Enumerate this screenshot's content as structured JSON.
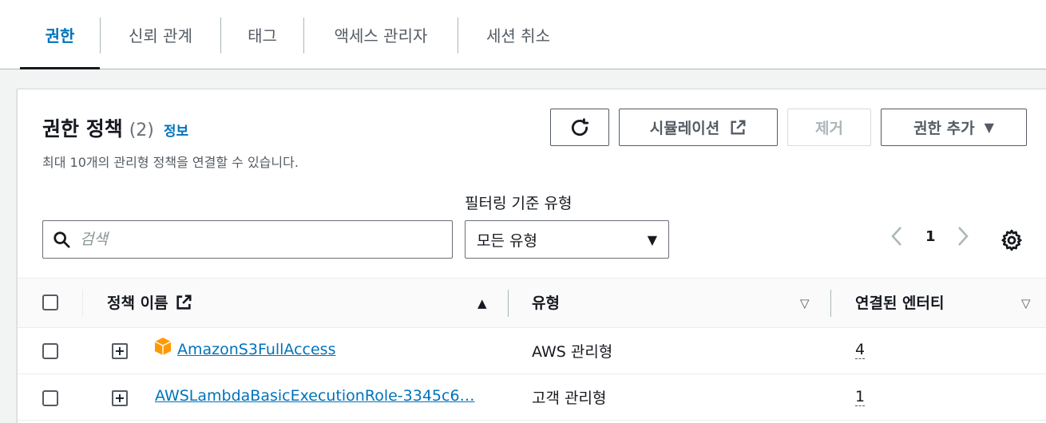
{
  "tabs": [
    {
      "label": "권한",
      "active": true
    },
    {
      "label": "신뢰 관계"
    },
    {
      "label": "태그"
    },
    {
      "label": "액세스 관리자"
    },
    {
      "label": "세션 취소"
    }
  ],
  "panel": {
    "title": "권한 정책",
    "count": "(2)",
    "info_link": "정보",
    "description": "최대 10개의 관리형 정책을 연결할 수 있습니다.",
    "refresh_icon": "refresh-icon",
    "simulation_label": "시뮬레이션",
    "remove_label": "제거",
    "add_permissions_label": "권한 추가"
  },
  "filters": {
    "search_placeholder": "검색",
    "type_label": "필터링 기준 유형",
    "type_value": "모든 유형"
  },
  "pagination": {
    "current_page": "1"
  },
  "table": {
    "columns": {
      "policy_name": "정책 이름",
      "type": "유형",
      "attached_entities": "연결된 엔터티"
    },
    "rows": [
      {
        "name": "AmazonS3FullAccess",
        "type": "AWS 관리형",
        "entities": "4",
        "icon": "aws-managed-cube-icon"
      },
      {
        "name": "AWSLambdaBasicExecutionRole-3345c6…",
        "type": "고객 관리형",
        "entities": "1"
      }
    ]
  },
  "colors": {
    "accent": "#0073bb",
    "aws_icon": "#f90"
  }
}
